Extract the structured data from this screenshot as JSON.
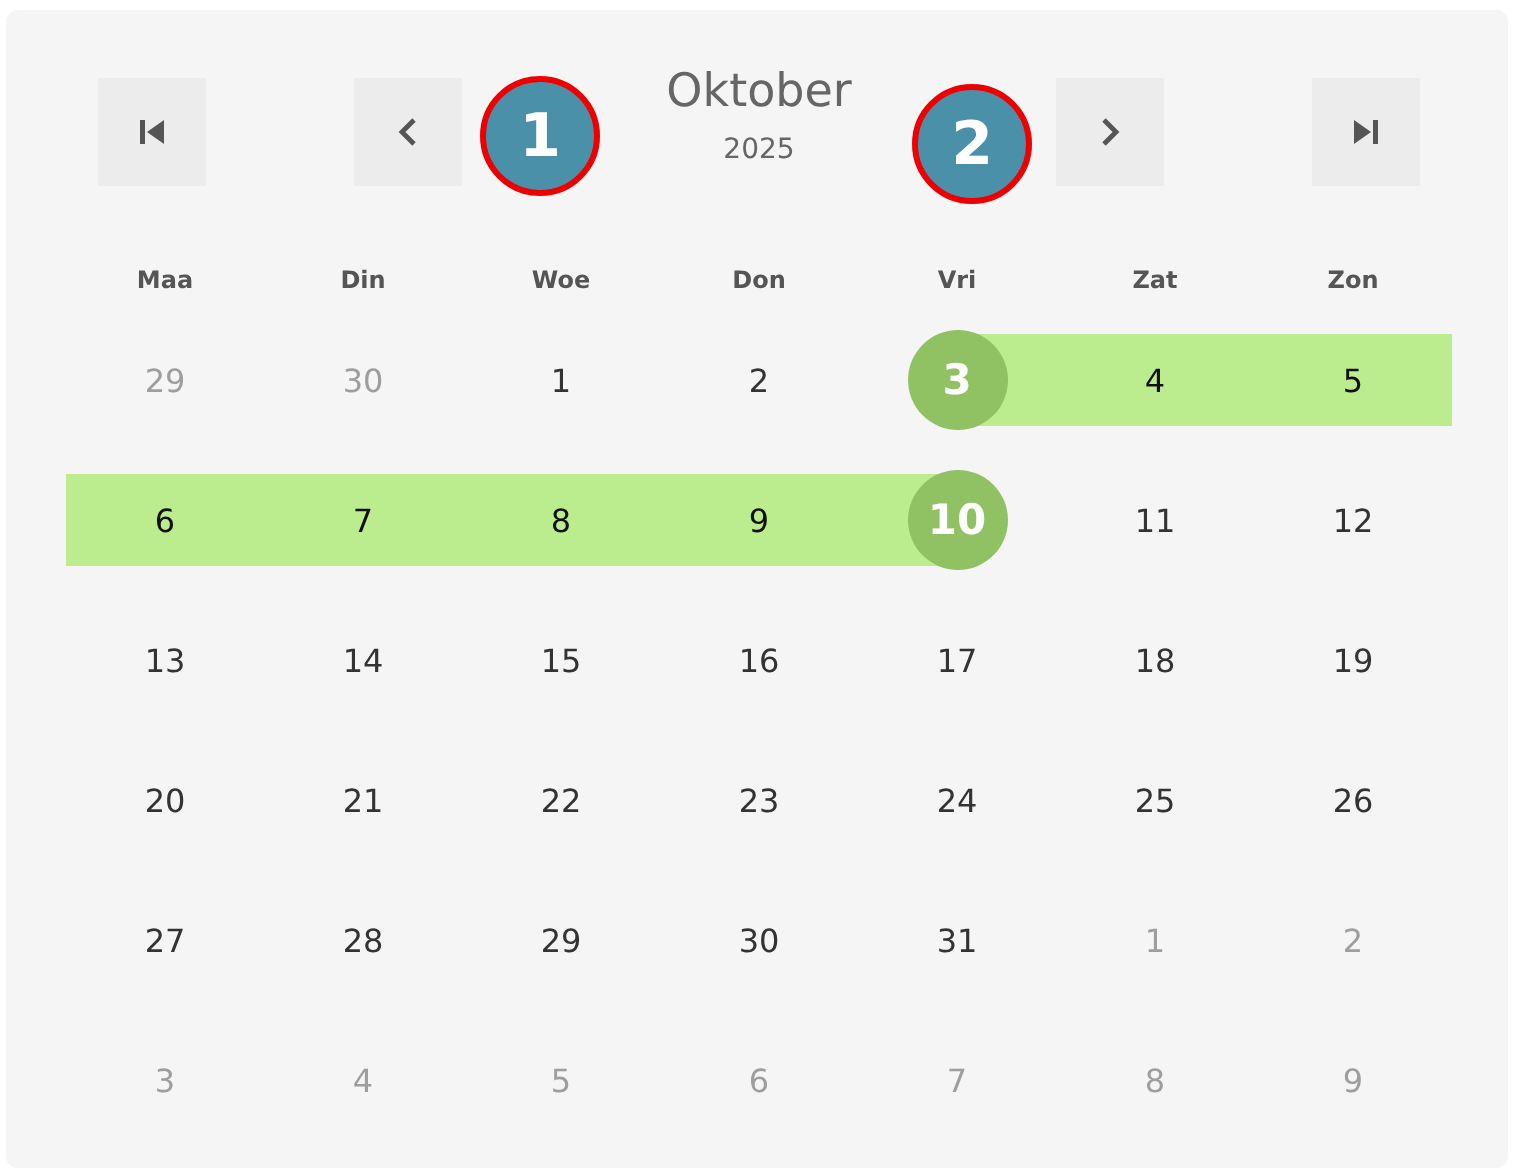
{
  "header": {
    "month": "Oktober",
    "year": "2025"
  },
  "nav_buttons": [
    {
      "kind": "first"
    },
    {
      "kind": "prev"
    },
    {
      "kind": "next"
    },
    {
      "kind": "last"
    }
  ],
  "weekdays": [
    "Maa",
    "Din",
    "Woe",
    "Don",
    "Vri",
    "Zat",
    "Zon"
  ],
  "weeks": [
    [
      {
        "label": "29",
        "kind": "outside"
      },
      {
        "label": "30",
        "kind": "outside"
      },
      {
        "label": "1",
        "kind": "plain"
      },
      {
        "label": "2",
        "kind": "plain"
      },
      {
        "label": "3",
        "kind": "start"
      },
      {
        "label": "4",
        "kind": "inrange"
      },
      {
        "label": "5",
        "kind": "inrange"
      }
    ],
    [
      {
        "label": "6",
        "kind": "inrange"
      },
      {
        "label": "7",
        "kind": "inrange"
      },
      {
        "label": "8",
        "kind": "inrange"
      },
      {
        "label": "9",
        "kind": "inrange"
      },
      {
        "label": "10",
        "kind": "end"
      },
      {
        "label": "11",
        "kind": "plain"
      },
      {
        "label": "12",
        "kind": "plain"
      }
    ],
    [
      {
        "label": "13",
        "kind": "plain"
      },
      {
        "label": "14",
        "kind": "plain"
      },
      {
        "label": "15",
        "kind": "plain"
      },
      {
        "label": "16",
        "kind": "plain"
      },
      {
        "label": "17",
        "kind": "plain"
      },
      {
        "label": "18",
        "kind": "plain"
      },
      {
        "label": "19",
        "kind": "plain"
      }
    ],
    [
      {
        "label": "20",
        "kind": "plain"
      },
      {
        "label": "21",
        "kind": "plain"
      },
      {
        "label": "22",
        "kind": "plain"
      },
      {
        "label": "23",
        "kind": "plain"
      },
      {
        "label": "24",
        "kind": "plain"
      },
      {
        "label": "25",
        "kind": "plain"
      },
      {
        "label": "26",
        "kind": "plain"
      }
    ],
    [
      {
        "label": "27",
        "kind": "plain"
      },
      {
        "label": "28",
        "kind": "plain"
      },
      {
        "label": "29",
        "kind": "plain"
      },
      {
        "label": "30",
        "kind": "plain"
      },
      {
        "label": "31",
        "kind": "plain"
      },
      {
        "label": "1",
        "kind": "outside"
      },
      {
        "label": "2",
        "kind": "outside"
      }
    ],
    [
      {
        "label": "3",
        "kind": "outside"
      },
      {
        "label": "4",
        "kind": "outside"
      },
      {
        "label": "5",
        "kind": "outside"
      },
      {
        "label": "6",
        "kind": "outside"
      },
      {
        "label": "7",
        "kind": "outside"
      },
      {
        "label": "8",
        "kind": "outside"
      },
      {
        "label": "9",
        "kind": "outside"
      }
    ]
  ],
  "callouts": [
    {
      "label": "1"
    },
    {
      "label": "2"
    }
  ]
}
